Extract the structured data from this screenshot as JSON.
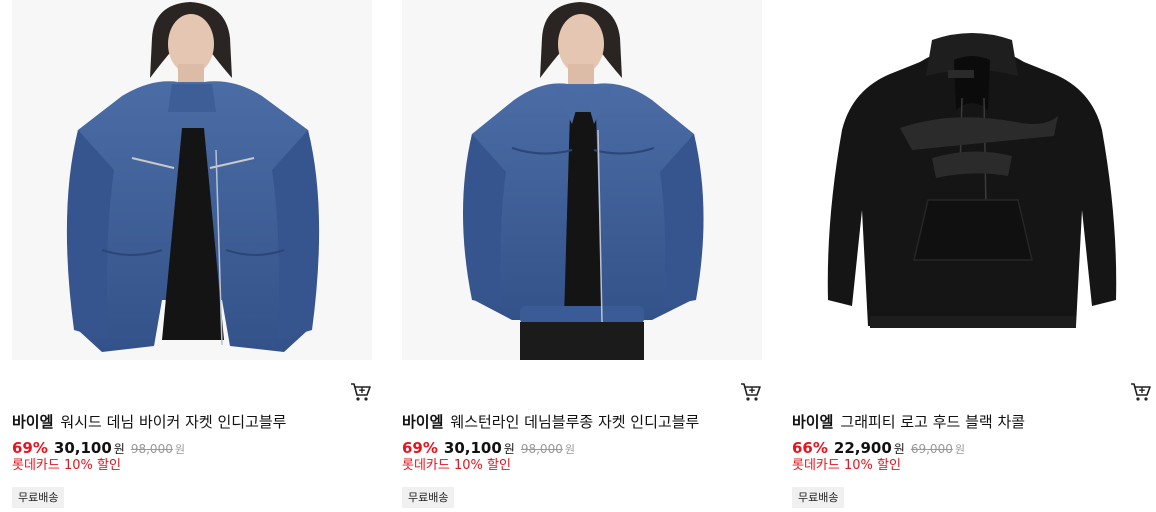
{
  "products": [
    {
      "brand": "바이엘",
      "name": "워시드 데님 바이커 자켓 인디고블루",
      "discount": "69%",
      "price": "30,100",
      "currency": "원",
      "original_price": "98,000",
      "original_currency": "원",
      "card_promo": "롯데카드 10% 할인",
      "tag": "무료배송",
      "image": "model-biker-denim-jacket",
      "cart_icon": "cart-icon"
    },
    {
      "brand": "바이엘",
      "name": "웨스턴라인 데님블루종 자켓 인디고블루",
      "discount": "69%",
      "price": "30,100",
      "currency": "원",
      "original_price": "98,000",
      "original_currency": "원",
      "card_promo": "롯데카드 10% 할인",
      "tag": "무료배송",
      "image": "model-western-denim-blouson",
      "cart_icon": "cart-icon"
    },
    {
      "brand": "바이엘",
      "name": "그래피티 로고 후드 블랙 차콜",
      "discount": "66%",
      "price": "22,900",
      "currency": "원",
      "original_price": "69,000",
      "original_currency": "원",
      "card_promo": "롯데카드 10% 할인",
      "tag": "무료배송",
      "image": "black-graffiti-hoodie",
      "cart_icon": "cart-icon"
    }
  ],
  "colors": {
    "accent": "#e6141e",
    "denim": "#3f5f95",
    "hoodie": "#151515"
  }
}
